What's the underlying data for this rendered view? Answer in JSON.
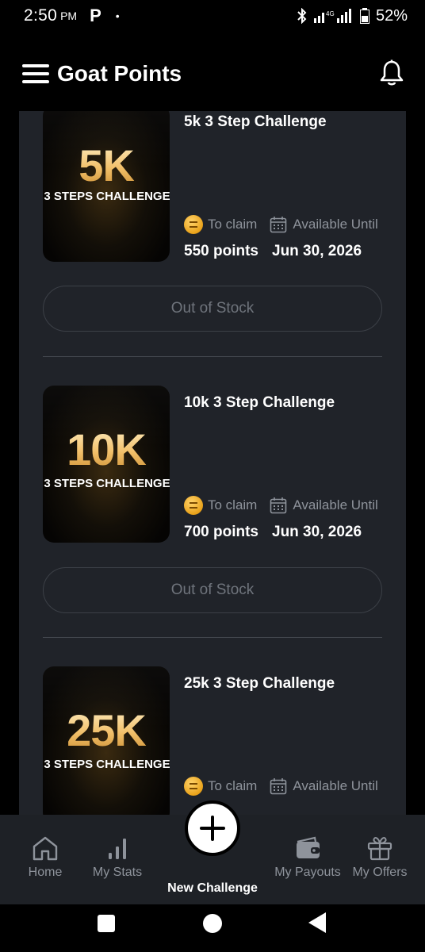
{
  "status_bar": {
    "time": "2:50",
    "ampm": "PM",
    "app_icon": "P",
    "dot": "•",
    "network": "4G",
    "battery": "52%"
  },
  "header": {
    "title": "Goat Points",
    "menu_icon": "hamburger-menu-icon",
    "notifications_icon": "bell-icon"
  },
  "challenges": [
    {
      "thumb_big": "5K",
      "thumb_sub": "3 STEPS CHALLENGE",
      "title": "5k 3 Step Challenge",
      "claim_label": "To claim",
      "until_label": "Available Until",
      "points": "550 points",
      "date": "Jun 30, 2026",
      "button": "Out of Stock"
    },
    {
      "thumb_big": "10K",
      "thumb_sub": "3 STEPS CHALLENGE",
      "title": "10k 3 Step Challenge",
      "claim_label": "To claim",
      "until_label": "Available Until",
      "points": "700 points",
      "date": "Jun 30, 2026",
      "button": "Out of Stock"
    },
    {
      "thumb_big": "25K",
      "thumb_sub": "3 STEPS CHALLENGE",
      "title": "25k 3 Step Challenge",
      "claim_label": "To claim",
      "until_label": "Available Until",
      "points": "",
      "date": "",
      "button": ""
    }
  ],
  "bottom_nav": {
    "home": "Home",
    "stats": "My Stats",
    "new_challenge": "New Challenge",
    "payouts": "My Payouts",
    "offers": "My Offers"
  },
  "colors": {
    "card_bg": "#202329",
    "nav_bg": "#1e2126",
    "muted_text": "#8e939b",
    "gold": "#f2c06a"
  }
}
